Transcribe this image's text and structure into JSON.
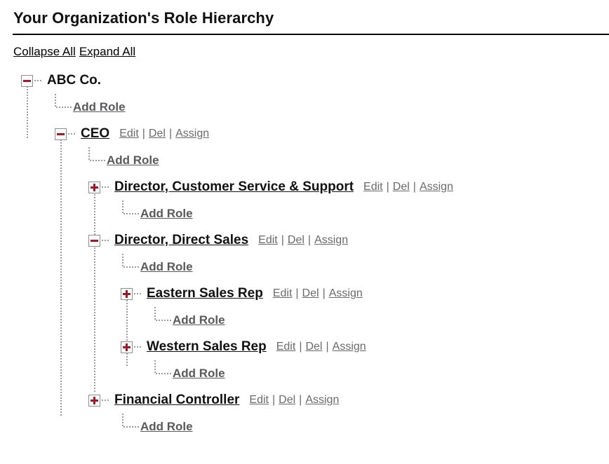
{
  "header": {
    "title": "Your Organization's Role Hierarchy"
  },
  "toolbar": {
    "collapse_all": "Collapse All",
    "expand_all": "Expand All"
  },
  "labels": {
    "add_role": "Add Role",
    "edit": "Edit",
    "del": "Del",
    "assign": "Assign",
    "separator": "|"
  },
  "colors": {
    "icon_accent": "#9b1c28",
    "icon_border": "#8f8f8f",
    "guide_line": "#9a9a9a",
    "action_link": "#6a6a6a",
    "add_role_link": "#59595b",
    "node_label": "#111111"
  },
  "tree": {
    "root": {
      "label": "ABC Co.",
      "toggle": "collapse-icon"
    },
    "nodes": [
      {
        "label": "CEO",
        "toggle": "collapse-icon",
        "depth": 1
      },
      {
        "label": "Director, Customer Service & Support",
        "toggle": "expand-icon",
        "depth": 2
      },
      {
        "label": "Director, Direct Sales",
        "toggle": "collapse-icon",
        "depth": 2
      },
      {
        "label": "Eastern Sales Rep",
        "toggle": "expand-icon",
        "depth": 3
      },
      {
        "label": "Western Sales Rep",
        "toggle": "expand-icon",
        "depth": 3
      },
      {
        "label": "Financial Controller",
        "toggle": "expand-icon",
        "depth": 2
      }
    ]
  }
}
